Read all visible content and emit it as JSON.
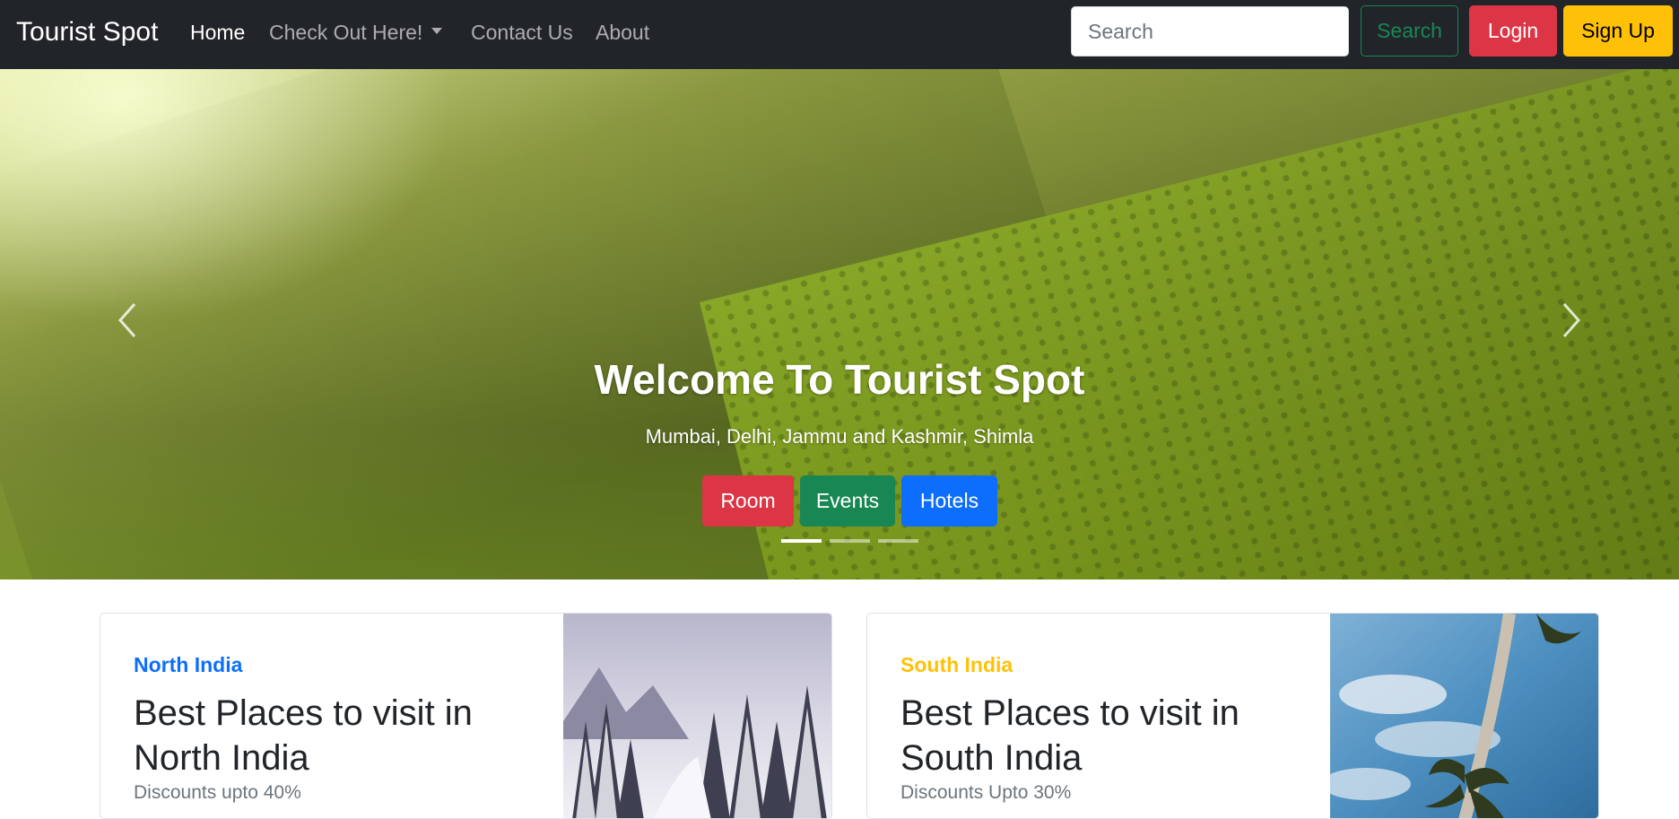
{
  "navbar": {
    "brand": "Tourist Spot",
    "links": [
      {
        "label": "Home",
        "active": true
      },
      {
        "label": "Check Out Here!",
        "dropdown": true
      },
      {
        "label": "Contact Us"
      },
      {
        "label": "About"
      }
    ],
    "search_placeholder": "Search",
    "search_button": "Search",
    "login_button": "Login",
    "signup_button": "Sign Up"
  },
  "hero": {
    "title": "Welcome To Tourist Spot",
    "subtitle": "Mumbai, Delhi, Jammu and Kashmir, Shimla",
    "buttons": [
      "Room",
      "Events",
      "Hotels"
    ],
    "slide_count": 3,
    "active_slide": 1
  },
  "cards": [
    {
      "tag": "North India",
      "tag_color": "#0d6efd",
      "title": "Best Places to visit in North India",
      "subtitle": "Discounts upto 40%"
    },
    {
      "tag": "South India",
      "tag_color": "#ffc107",
      "title": "Best Places to visit in South India",
      "subtitle": "Discounts Upto 30%"
    }
  ],
  "colors": {
    "navbar_bg": "#212529",
    "danger": "#dc3545",
    "success": "#198754",
    "primary": "#0d6efd",
    "warning": "#ffc107"
  },
  "icons": [
    "chevron-left-icon",
    "chevron-right-icon",
    "caret-down-icon"
  ]
}
